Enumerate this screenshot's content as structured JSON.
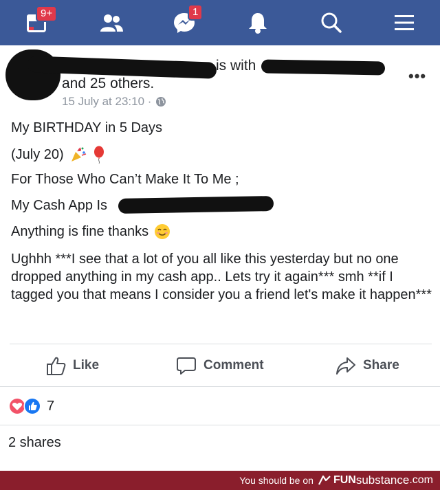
{
  "nav": {
    "calendar_badge": "9+",
    "messenger_badge": "1",
    "bar_color": "#3b5998"
  },
  "post": {
    "is_with": "is with",
    "others": "and 25 others.",
    "timestamp": "15 July at 23:10 ·",
    "more": "•••",
    "lines": [
      "My BIRTHDAY in 5 Days",
      "(July 20)",
      "For Those Who Can’t Make It To Me ;",
      "My Cash App Is",
      "Anything is fine thanks"
    ],
    "paragraph": "Ughhh ***I see that a lot of you all like this yesterday but no one dropped anything in my cash app.. Lets try it again*** smh **if I tagged you that means I consider you a friend let's make it happen***"
  },
  "actions": {
    "like": "Like",
    "comment": "Comment",
    "share": "Share"
  },
  "reactions": {
    "count": "7"
  },
  "shares": "2 shares",
  "footer": {
    "prefix": "You should be on",
    "brand_a": "FUN",
    "brand_b": "substance",
    "brand_c": ".com"
  }
}
